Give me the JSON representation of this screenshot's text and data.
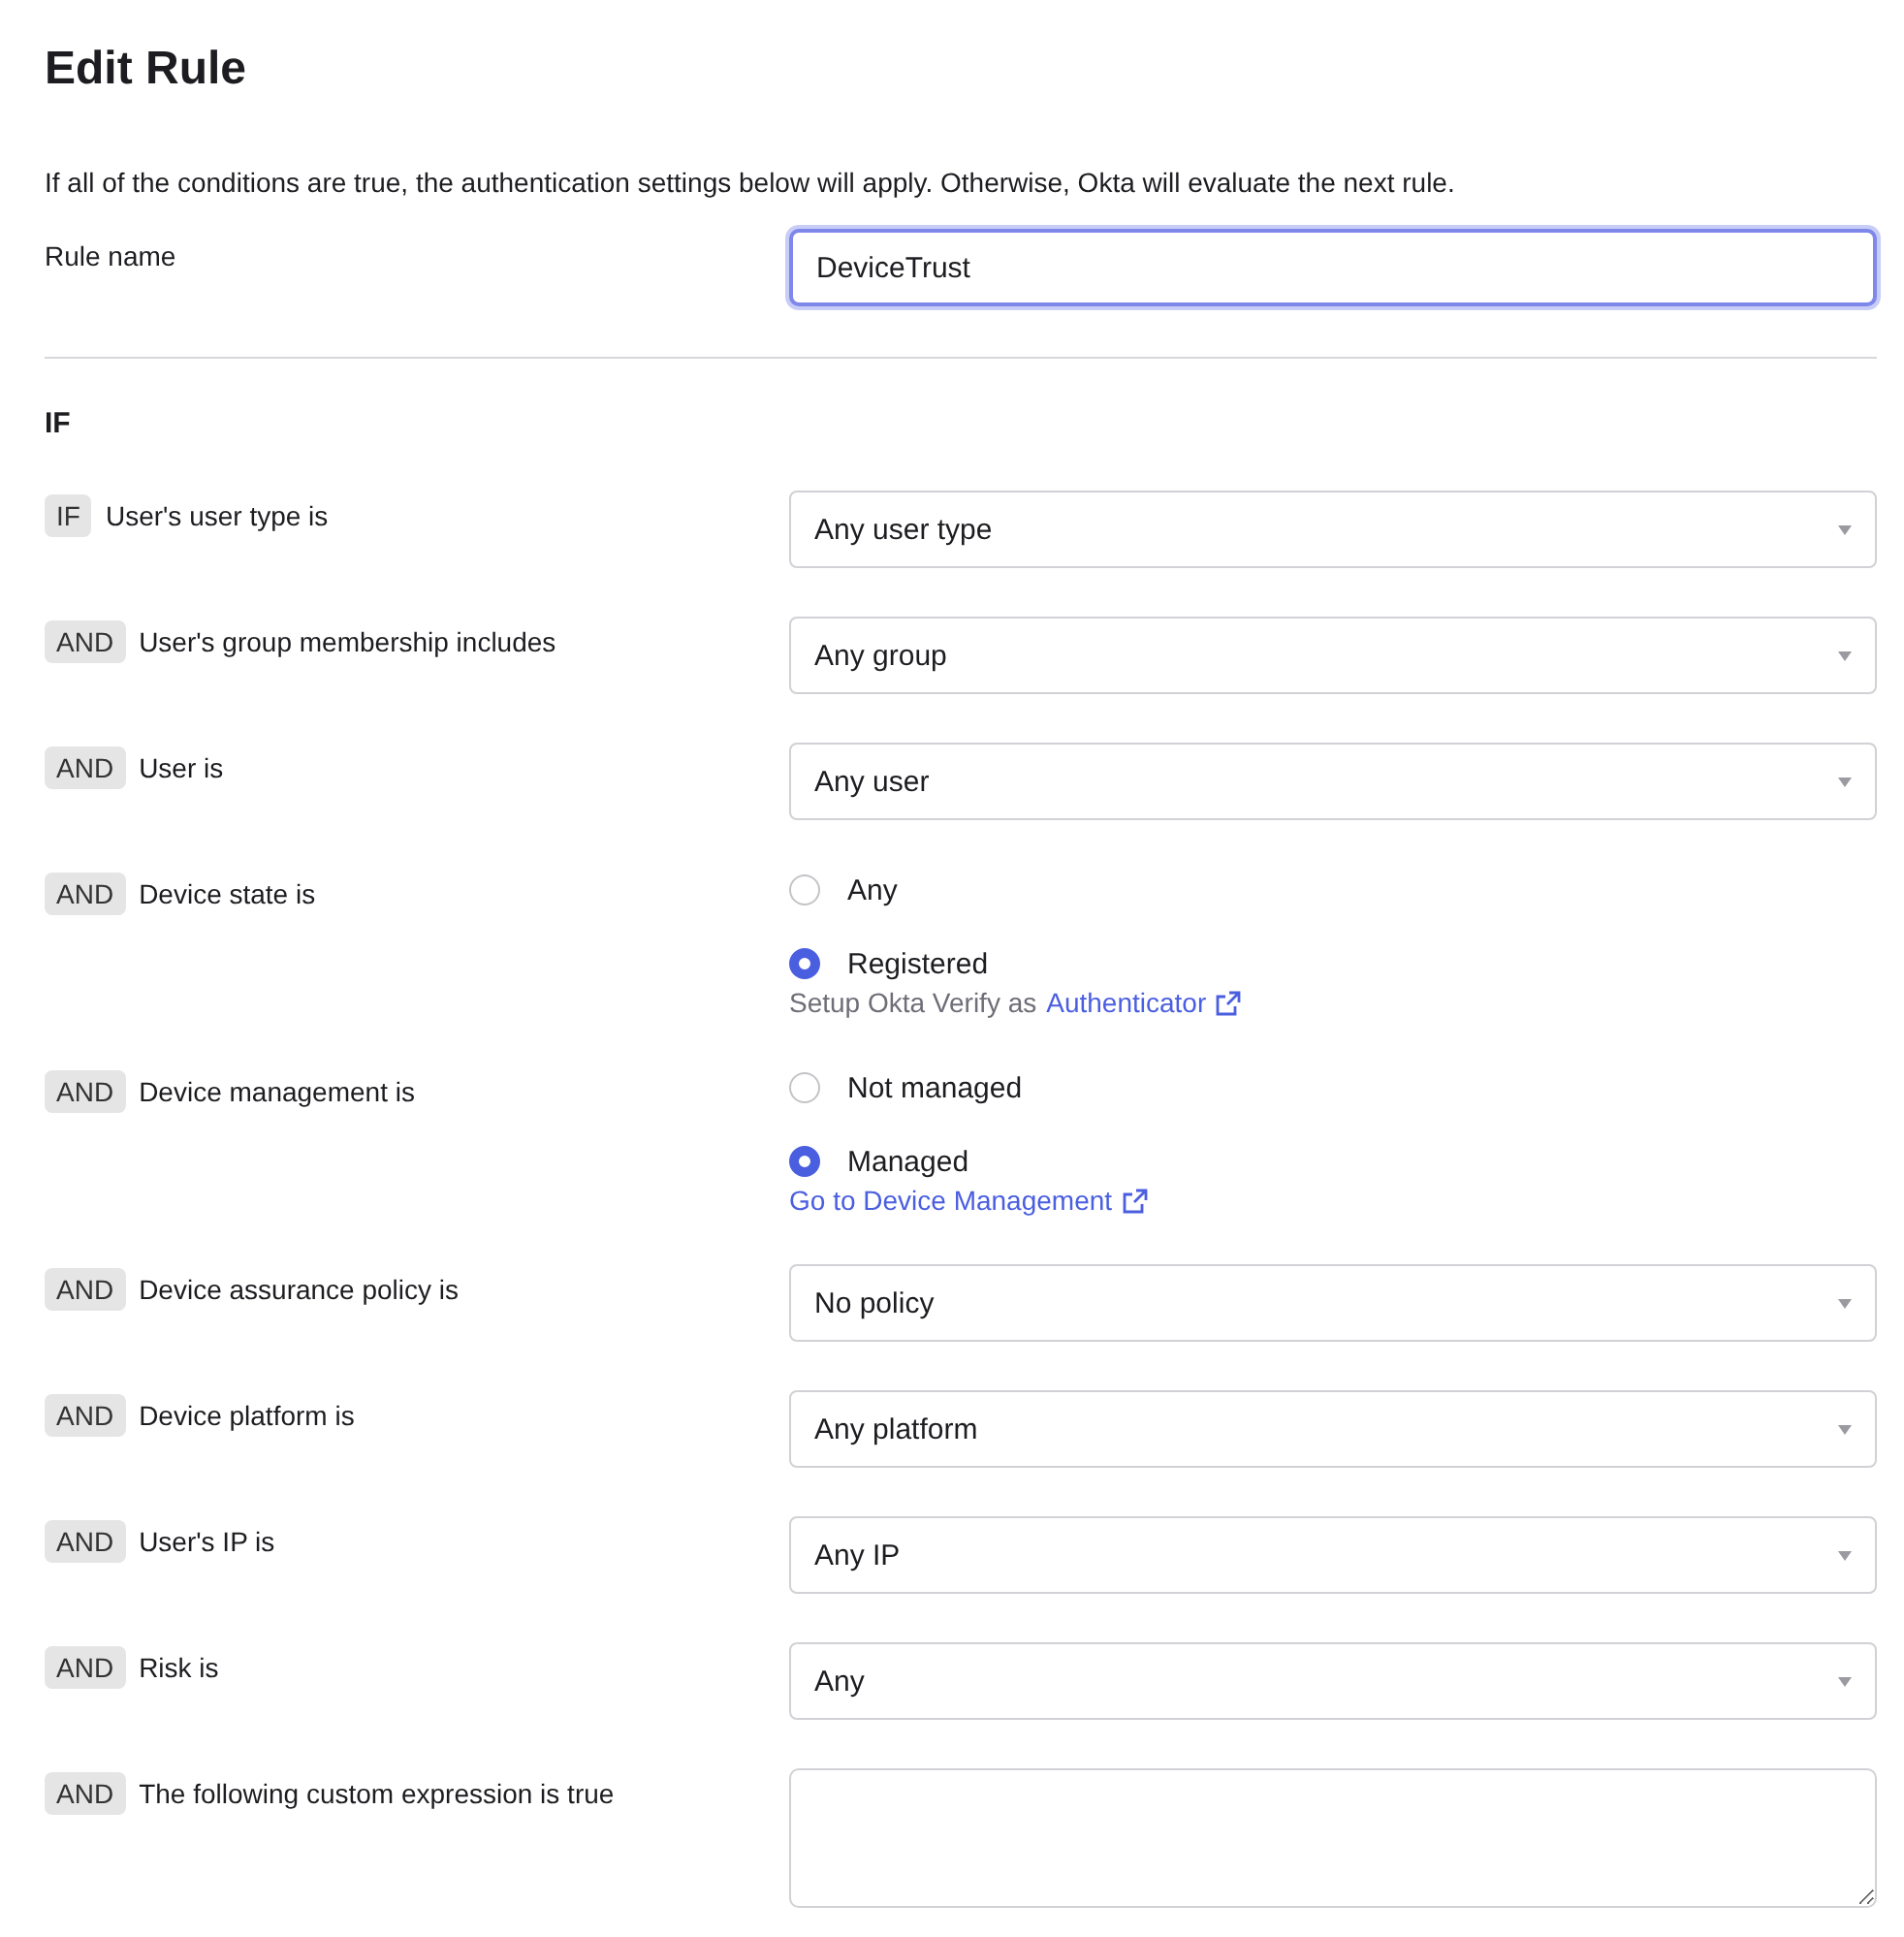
{
  "title": "Edit Rule",
  "description": "If all of the conditions are true, the authentication settings below will apply. Otherwise, Okta will evaluate the next rule.",
  "rule_name": {
    "label": "Rule name",
    "value": "DeviceTrust"
  },
  "section_heading": "IF",
  "conditions": [
    {
      "operator": "IF",
      "label": "User's user type is",
      "kind": "select",
      "value": "Any user type"
    },
    {
      "operator": "AND",
      "label": "User's group membership includes",
      "kind": "select",
      "value": "Any group"
    },
    {
      "operator": "AND",
      "label": "User is",
      "kind": "select",
      "value": "Any user"
    },
    {
      "operator": "AND",
      "label": "Device state is",
      "kind": "radio",
      "options": [
        {
          "label": "Any",
          "selected": false
        },
        {
          "label": "Registered",
          "selected": true
        }
      ],
      "helper": "Setup Okta Verify as",
      "link": "Authenticator"
    },
    {
      "operator": "AND",
      "label": "Device management is",
      "kind": "radio",
      "options": [
        {
          "label": "Not managed",
          "selected": false
        },
        {
          "label": "Managed",
          "selected": true
        }
      ],
      "link": "Go to Device Management"
    },
    {
      "operator": "AND",
      "label": "Device assurance policy is",
      "kind": "select",
      "value": "No policy"
    },
    {
      "operator": "AND",
      "label": "Device platform is",
      "kind": "select",
      "value": "Any platform"
    },
    {
      "operator": "AND",
      "label": "User's IP is",
      "kind": "select",
      "value": "Any IP"
    },
    {
      "operator": "AND",
      "label": "Risk is",
      "kind": "select",
      "value": "Any"
    },
    {
      "operator": "AND",
      "label": "The following custom expression is true",
      "kind": "textarea"
    }
  ]
}
